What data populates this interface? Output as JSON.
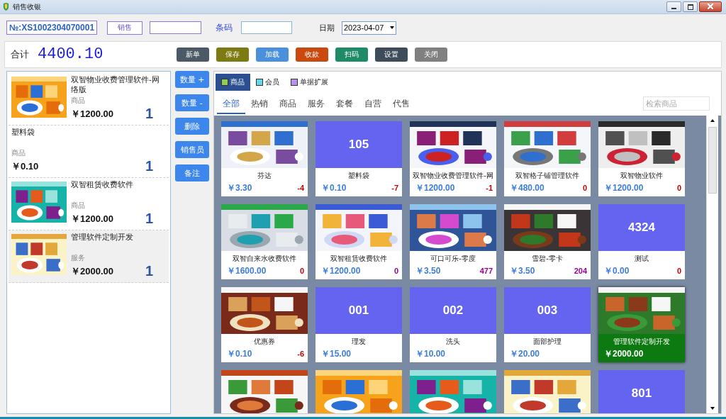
{
  "window": {
    "title": "销售收银"
  },
  "header": {
    "order_no": "№:XS1002304070001",
    "mode_button": "销售",
    "barcode_label": "条码",
    "date_label": "日期",
    "date": "2023-04-07"
  },
  "total": {
    "label": "合计",
    "amount": "4400.10"
  },
  "toolbar": [
    {
      "label": "新单",
      "color": "#4b5966"
    },
    {
      "label": "保存",
      "color": "#7b7b12"
    },
    {
      "label": "加载",
      "color": "#4a90dc"
    },
    {
      "label": "收款",
      "color": "#c9490f"
    },
    {
      "label": "扫码",
      "color": "#1f8a68"
    },
    {
      "label": "设置",
      "color": "#3e4c5a"
    },
    {
      "label": "关闭",
      "color": "#808080"
    }
  ],
  "cart": [
    {
      "image": {
        "kind": "picture"
      },
      "name": "双智物业收费管理软件-网络版",
      "type": "商品",
      "price": "￥1200.00",
      "qty": "1",
      "selected": false
    },
    {
      "name": "塑料袋",
      "type": "商品",
      "price": "￥0.10",
      "qty": "1",
      "selected": false
    },
    {
      "image": {
        "kind": "picture"
      },
      "name": "双智租赁收费软件",
      "type": "商品",
      "price": "￥1200.00",
      "qty": "1",
      "selected": false
    },
    {
      "image": {
        "kind": "picture"
      },
      "name": "管理软件定制开发",
      "type": "服务",
      "price": "￥2000.00",
      "qty": "1",
      "selected": true
    }
  ],
  "side_buttons": [
    "数量 +",
    "数量 -",
    "删除",
    "销售员",
    "备注"
  ],
  "categories": [
    {
      "label": "商品",
      "color": "#8fd14f",
      "selected": true
    },
    {
      "label": "会员",
      "color": "#66d6ea",
      "selected": false
    },
    {
      "label": "单据扩展",
      "color": "#b692ea",
      "selected": false
    }
  ],
  "filters": [
    {
      "label": "全部",
      "selected": true
    },
    {
      "label": "热销",
      "selected": false
    },
    {
      "label": "商品",
      "selected": false
    },
    {
      "label": "服务",
      "selected": false
    },
    {
      "label": "套餐",
      "selected": false
    },
    {
      "label": "自营",
      "selected": false
    },
    {
      "label": "代售",
      "selected": false
    }
  ],
  "search": {
    "placeholder": "检索商品"
  },
  "products": [
    {
      "image": {
        "kind": "picture"
      },
      "name": "芬达",
      "price": "￥3.30",
      "stock": "-4",
      "color": "#cc0000",
      "selected": false
    },
    {
      "image": {
        "kind": "code",
        "text": "105"
      },
      "name": "塑料袋",
      "price": "￥0.10",
      "stock": "-7",
      "color": "#cc0000",
      "selected": false
    },
    {
      "image": {
        "kind": "picture"
      },
      "name": "双智物业收费管理软件-网",
      "price": "￥1200.00",
      "stock": "-1",
      "color": "#cc0000",
      "selected": false
    },
    {
      "image": {
        "kind": "picture"
      },
      "name": "双智格子铺管理软件",
      "price": "￥480.00",
      "stock": "0",
      "color": "#cc0000",
      "selected": false
    },
    {
      "image": {
        "kind": "picture"
      },
      "name": "双智物业软件",
      "price": "￥1200.00",
      "stock": "0",
      "color": "#cc0000",
      "selected": false
    },
    {
      "image": {
        "kind": "picture"
      },
      "name": "双智自来水收费软件",
      "price": "￥1600.00",
      "stock": "0",
      "color": "#cc0000",
      "selected": false
    },
    {
      "image": {
        "kind": "picture"
      },
      "name": "双智租赁收费软件",
      "price": "￥1200.00",
      "stock": "0",
      "color": "#990099",
      "selected": false
    },
    {
      "image": {
        "kind": "picture"
      },
      "name": "可口可乐-零度",
      "price": "￥3.50",
      "stock": "477",
      "color": "#990099",
      "selected": false
    },
    {
      "image": {
        "kind": "picture"
      },
      "name": "雪碧-零卡",
      "price": "￥3.50",
      "stock": "204",
      "color": "#990099",
      "selected": false
    },
    {
      "image": {
        "kind": "code",
        "text": "4324"
      },
      "name": "测试",
      "price": "￥0.00",
      "stock": "0",
      "color": "#cc0000",
      "selected": false
    },
    {
      "image": {
        "kind": "picture"
      },
      "name": "优惠券",
      "price": "￥0.10",
      "stock": "-6",
      "color": "#cc0000",
      "selected": false
    },
    {
      "image": {
        "kind": "code",
        "text": "001"
      },
      "name": "理发",
      "price": "￥15.00",
      "selected": false
    },
    {
      "image": {
        "kind": "code",
        "text": "002"
      },
      "name": "洗头",
      "price": "￥10.00",
      "selected": false
    },
    {
      "image": {
        "kind": "code",
        "text": "003"
      },
      "name": "面部护理",
      "price": "￥20.00",
      "selected": false
    },
    {
      "image": {
        "kind": "picture"
      },
      "name": "管理软件定制开发",
      "price": "￥2000.00",
      "selected": true
    },
    {
      "image": {
        "kind": "picture"
      }
    },
    {
      "image": {
        "kind": "picture"
      }
    },
    {
      "image": {
        "kind": "picture"
      }
    },
    {
      "image": {
        "kind": "picture"
      }
    },
    {
      "image": {
        "kind": "code",
        "text": "801"
      }
    }
  ]
}
